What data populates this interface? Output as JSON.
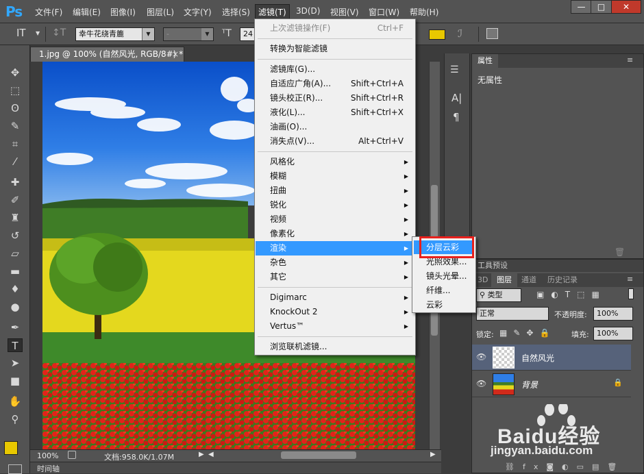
{
  "app": {
    "logo": "Ps"
  },
  "menubar": {
    "items": [
      "文件(F)",
      "编辑(E)",
      "图像(I)",
      "图层(L)",
      "文字(Y)",
      "选择(S)",
      "滤镜(T)",
      "3D(D)",
      "视图(V)",
      "窗口(W)",
      "帮助(H)"
    ],
    "active_index": 6,
    "window_buttons": {
      "minimize": "—",
      "restore": "□",
      "close": "✕"
    }
  },
  "options": {
    "tool_glyph": "IT",
    "font_family": "幸牛花绕青簏",
    "font_style": "-",
    "font_size": "24"
  },
  "document": {
    "tab_title": "1.jpg @ 100% (自然风光, RGB/8#) *",
    "close_glyph": "×",
    "zoom": "100%",
    "doc_info": "文档:958.0K/1.07M",
    "timeline_label": "时间轴"
  },
  "filter_menu": {
    "items": [
      {
        "label": "上次滤镜操作(F)",
        "shortcut": "Ctrl+F",
        "disabled": true
      },
      {
        "sep": true
      },
      {
        "label": "转换为智能滤镜"
      },
      {
        "sep": true
      },
      {
        "label": "滤镜库(G)..."
      },
      {
        "label": "自适应广角(A)...",
        "shortcut": "Shift+Ctrl+A"
      },
      {
        "label": "镜头校正(R)...",
        "shortcut": "Shift+Ctrl+R"
      },
      {
        "label": "液化(L)...",
        "shortcut": "Shift+Ctrl+X"
      },
      {
        "label": "油画(O)..."
      },
      {
        "label": "消失点(V)...",
        "shortcut": "Alt+Ctrl+V"
      },
      {
        "sep": true
      },
      {
        "label": "风格化",
        "submenu": true
      },
      {
        "label": "模糊",
        "submenu": true
      },
      {
        "label": "扭曲",
        "submenu": true
      },
      {
        "label": "锐化",
        "submenu": true
      },
      {
        "label": "视频",
        "submenu": true
      },
      {
        "label": "像素化",
        "submenu": true
      },
      {
        "label": "渲染",
        "submenu": true,
        "highlighted": true
      },
      {
        "label": "杂色",
        "submenu": true
      },
      {
        "label": "其它",
        "submenu": true
      },
      {
        "sep": true
      },
      {
        "label": "Digimarc",
        "submenu": true
      },
      {
        "label": "KnockOut 2",
        "submenu": true
      },
      {
        "label": "Vertus™",
        "submenu": true
      },
      {
        "sep": true
      },
      {
        "label": "浏览联机滤镜..."
      }
    ]
  },
  "render_submenu": {
    "items": [
      "分层云彩",
      "光照效果...",
      "镜头光晕...",
      "纤维...",
      "云彩"
    ],
    "highlighted_index": 0
  },
  "properties_panel": {
    "tab": "属性",
    "content": "无属性"
  },
  "tool_presets_tab": "工具预设",
  "layers_panel": {
    "tabs": [
      "3D",
      "图层",
      "通道",
      "历史记录"
    ],
    "active_tab": 1,
    "filter_type": "类型",
    "blend_mode": "正常",
    "opacity_label": "不透明度:",
    "opacity_value": "100%",
    "lock_label": "锁定:",
    "fill_label": "填充:",
    "fill_value": "100%",
    "layers": [
      {
        "name": "自然风光",
        "selected": true
      },
      {
        "name": "背景",
        "locked": true
      }
    ]
  },
  "watermark": {
    "brand": "Baidu经验",
    "url": "jingyan.baidu.com"
  },
  "colors": {
    "accent": "#3399ff",
    "highlight_box": "#e8201c",
    "foreground_swatch": "#e8c800"
  }
}
